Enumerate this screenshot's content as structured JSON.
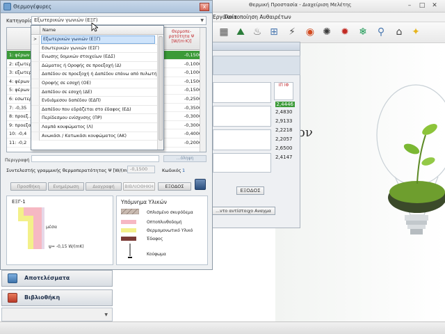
{
  "background_app": {
    "title": "Θερμική Προστασία - Διαχείριση Μελέτης",
    "menu": [
      "Εργαλεία",
      "Τακτοποίηση Αυθαιρέτων"
    ],
    "big_text": "ον",
    "values": [
      "2,4446",
      "2,4830",
      "2,9133",
      "2,2218",
      "2,2057",
      "2,6500",
      "2,4147"
    ],
    "values_header": "ΙΠ ΙΦ",
    "exit_label": "ΕΞΟΔΟΣ",
    "annex_button": "...ντο αντίστοιχο Αναγμα",
    "accent_color": "#3b9a38"
  },
  "dialog": {
    "title": "Θερμογέφυρες",
    "close_label": "x",
    "category_label": "Κατηγορία",
    "category_value": "Εξωτερικών γωνιών (ΕΞΓ)",
    "grid": {
      "header_right": "Θερμοπε-ρατότητα Ψ [W/(m·K)]",
      "rows": [
        {
          "name": "1: φέρων ...",
          "value": "-0,1500",
          "selected": true
        },
        {
          "name": "2: εξωτερ...",
          "value": "-0,1000"
        },
        {
          "name": "3: εξωτερ...",
          "value": "-0,1000"
        },
        {
          "name": "4: φέρων ...",
          "value": "-0,1500"
        },
        {
          "name": "5: φέρων ...",
          "value": "-0,1500"
        },
        {
          "name": "6: εσωτερ...",
          "value": "-0,2500"
        },
        {
          "name": "7: -0,35",
          "value": "-0,3500"
        },
        {
          "name": "8: προεξ...",
          "value": "-0,3000"
        },
        {
          "name": "9: προεξο...",
          "value": "-0,3000"
        },
        {
          "name": "10: -0,4",
          "value": "-0,4000"
        },
        {
          "name": "11: -0,2",
          "value": "-0,2000"
        }
      ]
    },
    "description_label": "Περιγραφή",
    "aux_header": "...όληψη",
    "coef_label": "Συντελεστής γραμμικής θερμοπερατότητας Ψ [W/(m·K)]",
    "coef_value": "-0,1500",
    "code_label": "Κωδικός",
    "code_value": "1",
    "buttons": {
      "add": "Προσθήκη",
      "update": "Ενημέρωση",
      "delete": "Διαγραφή",
      "library": "ΒΙΒΛΙΟΘΗΚΗ",
      "exit": "ΕΞΟΔΟΣ"
    },
    "drawing": {
      "title": "ΕΞΓ-1",
      "inside_label": "μέσα",
      "psi_label": "ψ= -0,15 W/(mK)"
    },
    "legend": {
      "title": "Υπόμνημα Υλικών",
      "items": [
        {
          "label": "Οπλισμένο σκυρόδεμα",
          "color": "#b8a79b"
        },
        {
          "label": "Οπτοπλινθοδομή",
          "color": "#f6b8c3"
        },
        {
          "label": "Θερμομονωτικό Υλικό",
          "color": "#f3f08a"
        },
        {
          "label": "Έδαφος",
          "color": "#7a3b36"
        },
        {
          "label": "Κούφωμα",
          "color": "#111111"
        }
      ]
    }
  },
  "dropdown": {
    "header": "Name",
    "selected_marker": ">",
    "options": [
      "Εξωτερικών γωνιών (ΕΞΓ)",
      "Εσωτερικών γωνιών (ΕΣΓ)",
      "Ενωσης δομικών στοιχείων (ΕΔΣ)",
      "Δώματος ή Οροφής σε προεξοχή (Δ)",
      "Δαπέδου σε προεξοχή ή Δαπέδου επάνω από πυλωτή (...",
      "Οροφής σε εσοχή (ΟΕ)",
      "Δαπέδου σε εσοχή (ΔΕ)",
      "Ενδιάμεσου δαπέδου (ΕΔΠ)",
      "Δαπέδου που εδράζεται στο έδαφος (ΕΔ)",
      "Περίδεσμου ενίσχυσης (ΠΡ)",
      "Λαμπά κουφώματος (Λ)",
      "Ανωκάσι / Κατωκάσι κουφώματος (ΑΚ)"
    ]
  },
  "nav": {
    "results": "Αποτελέσματα",
    "library": "Βιβλιοθήκη"
  }
}
